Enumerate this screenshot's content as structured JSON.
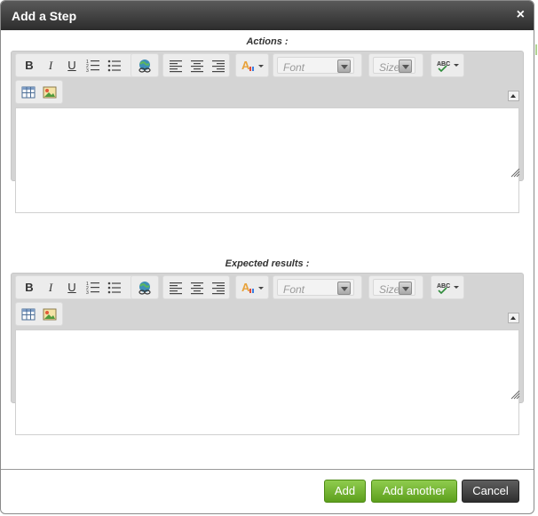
{
  "dialog": {
    "title": "Add a Step",
    "close_glyph": "×"
  },
  "editors": [
    {
      "label": "Actions :",
      "font_placeholder": "Font",
      "size_placeholder": "Size",
      "content": ""
    },
    {
      "label": "Expected results :",
      "font_placeholder": "Font",
      "size_placeholder": "Size",
      "content": ""
    }
  ],
  "toolbar_glyphs": {
    "bold": "B",
    "italic": "I",
    "underline": "U"
  },
  "buttons": {
    "add": "Add",
    "add_another": "Add another",
    "cancel": "Cancel"
  },
  "colors": {
    "titlebar": "#3a3a3a",
    "primary_button": "#6cae2b",
    "cancel_button": "#3a3a3a",
    "editor_frame": "#d4d4d4"
  }
}
